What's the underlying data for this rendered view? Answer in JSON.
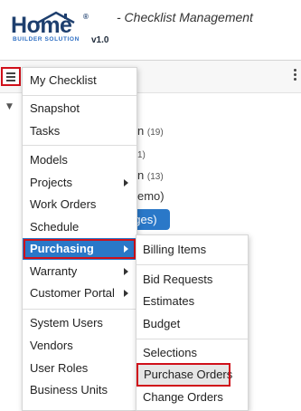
{
  "header": {
    "logo_word": "Home",
    "logo_registered": "®",
    "logo_subtitle": "BUILDER SOLUTION",
    "logo_version": "v1.0",
    "subtitle": "- Checklist Management"
  },
  "toolbar": {
    "menu_icon": "hamburger-icon",
    "more_icon": "kebab-icon"
  },
  "background": {
    "items": [
      {
        "text": "n",
        "count": "(19)"
      },
      {
        "text": "",
        "count": "1)"
      },
      {
        "text": "n",
        "count": "(13)"
      },
      {
        "text": "emo)",
        "count": ""
      },
      {
        "text": "ages)",
        "count": ""
      }
    ]
  },
  "menu": {
    "items": [
      {
        "label": "My Checklist"
      },
      {
        "label": "Snapshot"
      },
      {
        "label": "Tasks"
      },
      {
        "label": "Models"
      },
      {
        "label": "Projects",
        "has_submenu": true
      },
      {
        "label": "Work Orders"
      },
      {
        "label": "Schedule"
      },
      {
        "label": "Purchasing",
        "has_submenu": true,
        "active": true
      },
      {
        "label": "Warranty",
        "has_submenu": true
      },
      {
        "label": "Customer Portal",
        "has_submenu": true
      },
      {
        "label": "System Users"
      },
      {
        "label": "Vendors"
      },
      {
        "label": "User Roles"
      },
      {
        "label": "Business Units"
      }
    ]
  },
  "submenu": {
    "items": [
      {
        "label": "Billing Items"
      },
      {
        "label": "Bid Requests"
      },
      {
        "label": "Estimates"
      },
      {
        "label": "Budget"
      },
      {
        "label": "Selections"
      },
      {
        "label": "Purchase Orders",
        "highlighted": true
      },
      {
        "label": "Change Orders"
      }
    ]
  },
  "colors": {
    "accent": "#2a78c8",
    "highlight_outline": "#d0101a",
    "logo_navy": "#1e3f6e"
  }
}
